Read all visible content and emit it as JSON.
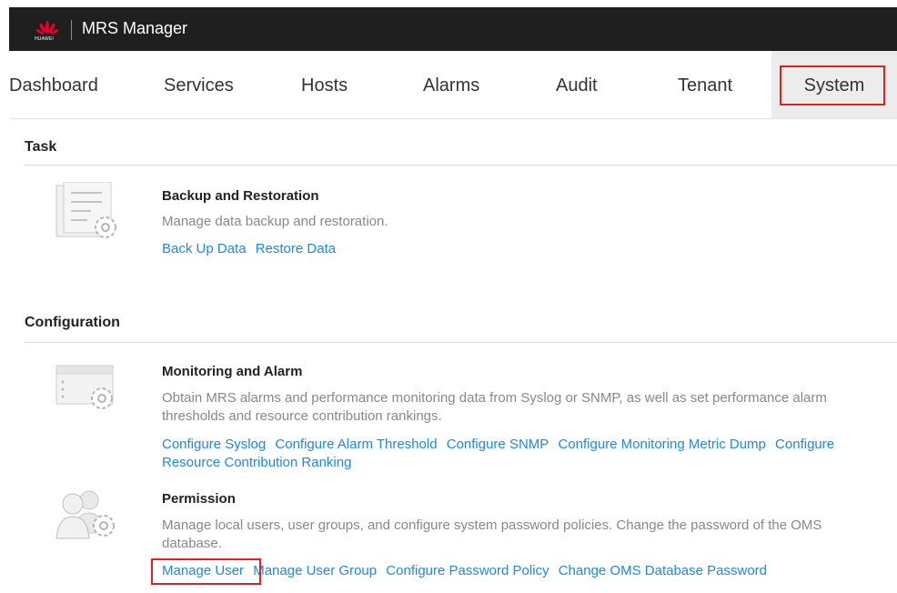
{
  "header": {
    "brand": "HUAWEI",
    "app_title": "MRS Manager"
  },
  "nav": {
    "tabs": [
      "Dashboard",
      "Services",
      "Hosts",
      "Alarms",
      "Audit",
      "Tenant",
      "System"
    ],
    "active": "System"
  },
  "task": {
    "title": "Task",
    "items": [
      {
        "title": "Backup and Restoration",
        "description": "Manage data backup and restoration.",
        "links": [
          "Back Up Data",
          "Restore Data"
        ]
      }
    ]
  },
  "configuration": {
    "title": "Configuration",
    "monitoring": {
      "title": "Monitoring and Alarm",
      "description": "Obtain MRS alarms and performance monitoring data from Syslog or SNMP, as well as set performance alarm thresholds and resource contribution rankings.",
      "links": [
        "Configure Syslog",
        "Configure Alarm Threshold",
        "Configure SNMP",
        "Configure Monitoring Metric Dump",
        "Configure Resource Contribution Ranking"
      ]
    },
    "permission": {
      "title": "Permission",
      "description": "Manage local users, user groups, and configure system password policies. Change the password of the OMS database.",
      "links": [
        "Manage User",
        "Manage User Group",
        "Configure Password Policy",
        "Change OMS Database Password"
      ]
    }
  },
  "colors": {
    "topbar": "#1f1f1f",
    "link": "#1e88e5",
    "highlight": "#e02020",
    "brand_red": "#e4002b"
  }
}
